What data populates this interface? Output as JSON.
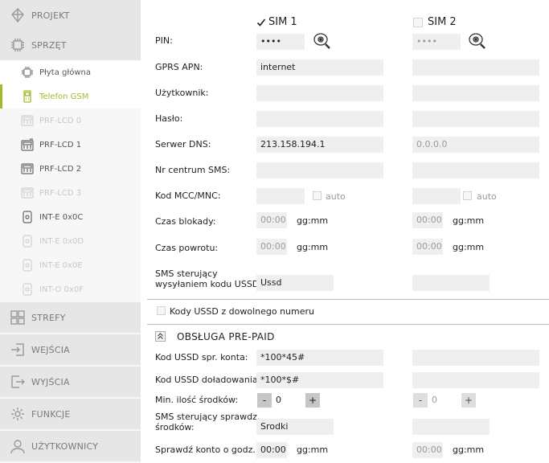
{
  "sidebar": {
    "sections": [
      {
        "label": "PROJEKT",
        "icon": "project-icon"
      },
      {
        "label": "SPRZĘT",
        "icon": "hardware-icon"
      },
      {
        "label": "STREFY",
        "icon": "zones-icon"
      },
      {
        "label": "WEJŚCIA",
        "icon": "inputs-icon"
      },
      {
        "label": "WYJŚCIA",
        "icon": "outputs-icon"
      },
      {
        "label": "FUNKCJE",
        "icon": "gear-icon"
      },
      {
        "label": "UŻYTKOWNICY",
        "icon": "user-icon"
      }
    ],
    "devices": [
      {
        "label": "Płyta główna",
        "icon": "chip-icon"
      },
      {
        "label": "Telefon GSM",
        "icon": "phone-icon"
      },
      {
        "label": "PRF-LCD 0",
        "icon": "keypad-icon"
      },
      {
        "label": "PRF-LCD 1",
        "icon": "keypad-wireless-icon"
      },
      {
        "label": "PRF-LCD 2",
        "icon": "keypad-icon"
      },
      {
        "label": "PRF-LCD 3",
        "icon": "keypad-icon"
      },
      {
        "label": "INT-E 0x0C",
        "icon": "module-icon"
      },
      {
        "label": "INT-E 0x0D",
        "icon": "module-icon"
      },
      {
        "label": "INT-E 0x0E",
        "icon": "module-icon"
      },
      {
        "label": "INT-O 0x0F",
        "icon": "module-icon"
      }
    ]
  },
  "sim1": {
    "label": "SIM 1",
    "checked": true
  },
  "sim2": {
    "label": "SIM 2",
    "checked": false
  },
  "labels": {
    "pin": "PIN:",
    "apn": "GPRS APN:",
    "user": "Użytkownik:",
    "pass": "Hasło:",
    "dns": "Serwer DNS:",
    "sms_center": "Nr centrum SMS:",
    "mcc": "Kod MCC/MNC:",
    "lock_time": "Czas blokady:",
    "return_time": "Czas powrotu:",
    "sms_ussd_1": "SMS sterujący",
    "sms_ussd_2": "wysyłaniem kodu USSD:",
    "auto": "auto",
    "unit_time": "gg:mm",
    "ussd_any": "Kody USSD z dowolnego numeru",
    "prepaid": "OBSŁUGA PRE-PAID",
    "ussd_check": "Kod USSD spr. konta:",
    "ussd_topup": "Kod USSD doładowania:",
    "min_funds": "Min. ilość środków:",
    "sms_check_1": "SMS sterujący sprawdz.",
    "sms_check_2": "środków:",
    "check_at": "Sprawdź konto o godz.:"
  },
  "values1": {
    "pin": "••••",
    "apn": "internet",
    "user": "",
    "pass": "",
    "dns": "213.158.194.1",
    "sms_center": "",
    "mcc": "",
    "lock_time": "00:00",
    "return_time": "00:00",
    "sms_ussd": "Ussd",
    "ussd_check": "*100*45#",
    "ussd_topup": "*100*$#",
    "min_funds": "0",
    "sms_check": "Srodki",
    "check_at": "00:00"
  },
  "values2": {
    "pin": "••••",
    "apn": "",
    "user": "",
    "pass": "",
    "dns": "0.0.0.0",
    "sms_center": "",
    "mcc": "",
    "lock_time": "00:00",
    "return_time": "00:00",
    "sms_ussd": "",
    "ussd_check": "",
    "ussd_topup": "",
    "min_funds": "0",
    "sms_check": "",
    "check_at": "00:00"
  },
  "stepper": {
    "minus": "-",
    "plus": "+"
  },
  "colors": {
    "accent": "#9dbd2a",
    "field_bg": "#efefef",
    "sidebar_section": "#e6e6e6"
  }
}
